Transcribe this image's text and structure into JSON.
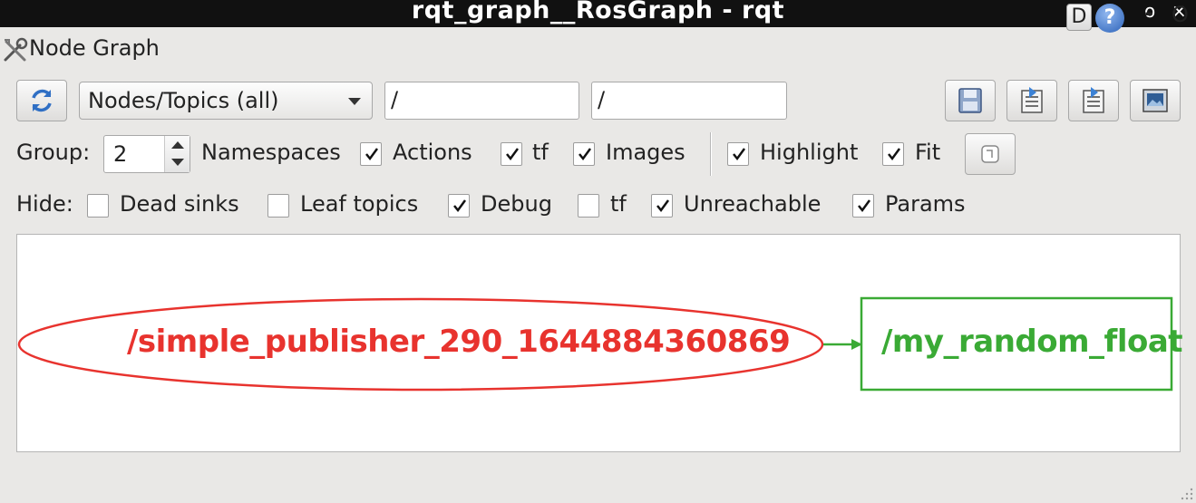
{
  "window": {
    "title": "rqt_graph__RosGraph - rqt",
    "controls": [
      "o",
      "×"
    ]
  },
  "plugin": {
    "title": "Node Graph",
    "d_label": "D",
    "help_label": "?",
    "minimize_label": "-",
    "close_label": "O"
  },
  "toolbar": {
    "graph_mode": "Nodes/Topics (all)",
    "node_filter": "/",
    "topic_filter": "/"
  },
  "group_row": {
    "group_label": "Group:",
    "group_value": "2",
    "namespaces_label": "Namespaces",
    "namespaces_checked": true,
    "actions_label": "Actions",
    "actions_checked": true,
    "tf_label": "tf",
    "tf_checked": true,
    "images_label": "Images",
    "images_checked": true,
    "highlight_label": "Highlight",
    "highlight_checked": true,
    "fit_label": "Fit"
  },
  "hide_row": {
    "hide_label": "Hide:",
    "dead_sinks_label": "Dead sinks",
    "dead_sinks_checked": false,
    "leaf_topics_label": "Leaf topics",
    "leaf_topics_checked": false,
    "debug_label": "Debug",
    "debug_checked": true,
    "tf_label": "tf",
    "tf_checked": false,
    "unreachable_label": "Unreachable",
    "unreachable_checked": true,
    "params_label": "Params",
    "params_checked": true
  },
  "graph": {
    "node_name": "/simple_publisher_290_1644884360869",
    "topic_name": "/my_random_float",
    "node_color": "#e8332e",
    "topic_color": "#3aaa35"
  },
  "colors": {
    "titlebar": "#111111",
    "window_bg": "#e9e8e6",
    "help_blue": "#2c62b8"
  }
}
